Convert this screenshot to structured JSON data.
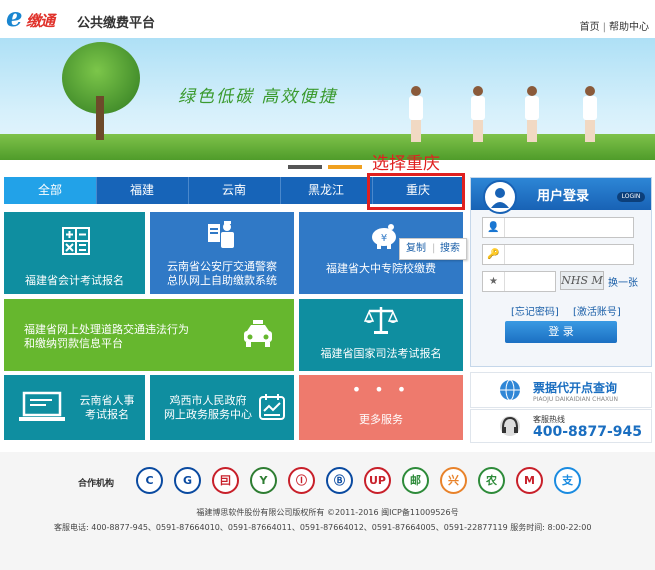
{
  "header": {
    "logo_letter": "e",
    "logo_text": "缴通",
    "site_title": "公共缴费平台",
    "links": [
      "首页",
      "帮助中心"
    ],
    "link_separator": "|"
  },
  "banner": {
    "slogan": "绿色低碳 高效便捷"
  },
  "annotation": "选择重庆",
  "tabs": [
    {
      "label": "全部",
      "active": true
    },
    {
      "label": "福建",
      "active": false
    },
    {
      "label": "云南",
      "active": false
    },
    {
      "label": "黑龙江",
      "active": false
    },
    {
      "label": "重庆",
      "active": false
    }
  ],
  "tiles": [
    {
      "id": "fujian-accounting-exam",
      "label": "福建省会计考试报名",
      "color": "#0f8ea0"
    },
    {
      "id": "yunnan-traffic-police",
      "label_lines": [
        "云南省公安厅交通警察",
        "总队网上自助缴款系统"
      ],
      "color": "#3079c6"
    },
    {
      "id": "fujian-college-fees",
      "label": "福建省大中专院校缴费",
      "color": "#3079c6"
    },
    {
      "id": "fujian-traffic-violation",
      "label_lines": [
        "福建省网上处理道路交通违法行为",
        "和缴纳罚款信息平台"
      ],
      "color": "#66b72e"
    },
    {
      "id": "fujian-judicial-exam",
      "label": "福建省国家司法考试报名",
      "color": "#0f8ea0"
    },
    {
      "id": "yunnan-personnel-exam",
      "label_lines": [
        "云南省人事",
        "考试报名"
      ],
      "color": "#0f8ea0"
    },
    {
      "id": "jixi-government",
      "label_lines": [
        "鸡西市人民政府",
        "网上政务服务中心"
      ],
      "color": "#0f8ea0"
    },
    {
      "id": "more-services",
      "label": "更多服务",
      "dots": "• • •",
      "color": "#ee7a6d"
    }
  ],
  "context_menu": {
    "copy": "复制",
    "search": "搜索"
  },
  "login": {
    "title": "用户登录",
    "tag": "LOGIN",
    "captcha_text": "NHS M",
    "refresh": "换一张",
    "forgot_password": "[忘记密码]",
    "activate_account": "[激活账号]",
    "button": "登 录"
  },
  "ticket_query": {
    "title": "票据代开点查询",
    "sub": "PIAOJU DAIKAIDIAN CHAXUN"
  },
  "hotline": {
    "title": "客服热线",
    "number": "400-8877-945"
  },
  "footer": {
    "partners_label": "合作机构",
    "bank_glyphs": [
      "C",
      "G",
      "囙",
      "Y",
      "Ⓘ",
      "Ⓑ",
      "UP",
      "邮",
      "兴",
      "农",
      "M",
      "支"
    ],
    "bank_colors": [
      "#0a4aa0",
      "#0a4aa0",
      "#c8202a",
      "#2e7d32",
      "#c8202a",
      "#0a4aa0",
      "#c8202a",
      "#2e8b3a",
      "#e8822a",
      "#2e8b3a",
      "#c8202a",
      "#1a8be0"
    ],
    "copyright": "福建博思软件股份有限公司版权所有  ©2011-2016 闽ICP备11009526号",
    "contact": "客服电话: 400-8877-945、0591-87664010、0591-87664011、0591-87664012、0591-87664005、0591-22877119 服务时间: 8:00-22:00"
  }
}
